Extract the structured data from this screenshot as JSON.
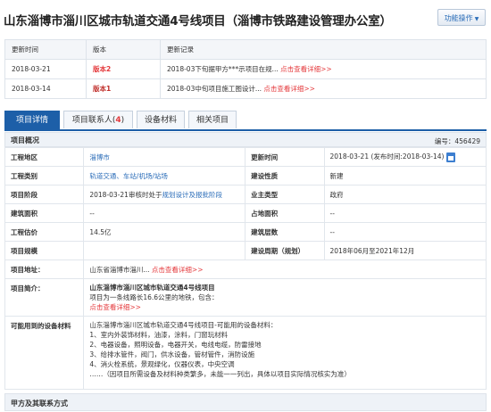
{
  "header": {
    "title": "山东淄博市淄川区城市轨道交通4号线项目（淄博市铁路建设管理办公室）",
    "func_button": "功能操作"
  },
  "records": {
    "headers": [
      "更新时间",
      "版本",
      "更新记录"
    ],
    "rows": [
      {
        "date": "2018-03-21",
        "version": "版本2",
        "text": "2018-03下旬据甲方***示项目在规...",
        "link": "点击查看详细>>"
      },
      {
        "date": "2018-03-14",
        "version": "版本1",
        "text": "2018-03中旬项目施工图设计...",
        "link": "点击查看详细>>"
      }
    ]
  },
  "tabs": [
    {
      "label": "项目详情"
    },
    {
      "label": "项目联系人",
      "count": "4"
    },
    {
      "label": "设备材料"
    },
    {
      "label": "相关项目"
    }
  ],
  "overview": {
    "title": "项目概况",
    "code_label": "编号：",
    "code": "456429"
  },
  "info": {
    "location_k": "工程地区",
    "location_v": "淄博市",
    "update_k": "更新时间",
    "update_v": "2018-03-21 (发布时间:2018-03-14)",
    "category_k": "工程类别",
    "category_v": "轨道交通、车站/机场/站场",
    "nature_k": "建设性质",
    "nature_v": "新建",
    "stage_k": "项目阶段",
    "stage_pre": "2018-03-21审核时处于",
    "stage_link": "规划设计及报批阶段",
    "owner_k": "业主类型",
    "owner_v": "政府",
    "area_k": "建筑面积",
    "area_v": "--",
    "land_k": "占地面积",
    "land_v": "--",
    "cost_k": "工程估价",
    "cost_v": "14.5亿",
    "floors_k": "建筑层数",
    "floors_v": "--",
    "scale_k": "项目规模",
    "scale_v": "",
    "period_k": "建设周期（规划）",
    "period_v": "2018年06月至2021年12月",
    "addr_k": "项目地址：",
    "addr_v": "山东省淄博市淄川...",
    "addr_link": "点击查看详细>>",
    "intro_k": "项目简介：",
    "intro_title": "山东淄博市淄川区城市轨道交通4号线项目",
    "intro_text": "项目为一条线路长16.6公里的地铁，包含：",
    "intro_link": "点击查看详细>>",
    "equip_k": "可能用到的设备材料",
    "equip_lines": [
      "山东淄博市淄川区城市轨道交通4号线项目-可能用的设备材料：",
      "1、室内外装饰材料，油漆，涂料，门窗玩材料",
      "2、电器设备，照明设备，电器开关，电线电缆，防雷接地",
      "3、给排水管件，阀门，供水设备，管材管件，消防设施",
      "4、消火栓系统，景观绿化，仪器仪表，中央空调",
      "……（因项目所需设备及材料种类繁多，未能一一列出，具体以项目实际情况核实为准）"
    ]
  },
  "section2": {
    "title": "甲方及其联系方式"
  }
}
